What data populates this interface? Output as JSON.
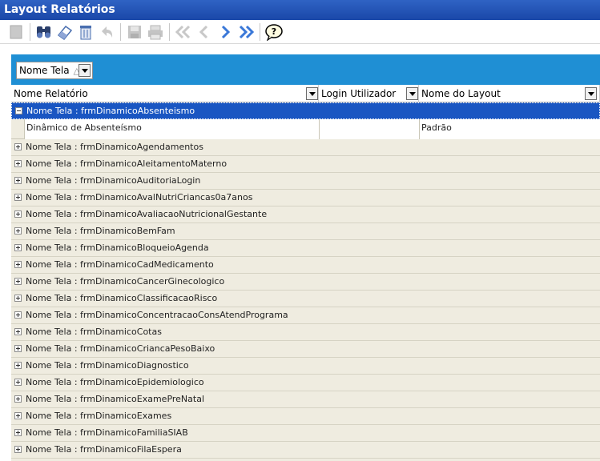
{
  "window": {
    "title": "Layout Relatórios"
  },
  "toolbar": {
    "buttons": [
      {
        "name": "new-icon",
        "enabled": false
      },
      {
        "name": "find-binoculars-icon",
        "enabled": true
      },
      {
        "name": "eraser-icon",
        "enabled": true
      },
      {
        "name": "delete-trash-icon",
        "enabled": true
      },
      {
        "name": "undo-icon",
        "enabled": false
      },
      {
        "name": "save-icon",
        "enabled": false
      },
      {
        "name": "print-icon",
        "enabled": false
      },
      {
        "name": "first-record-icon",
        "enabled": false
      },
      {
        "name": "previous-record-icon",
        "enabled": false
      },
      {
        "name": "next-record-icon",
        "enabled": true
      },
      {
        "name": "last-record-icon",
        "enabled": true
      },
      {
        "name": "help-icon",
        "enabled": true
      }
    ]
  },
  "grouping": {
    "label": "Nome Tela",
    "sort_indicator": "△"
  },
  "columns": {
    "nome_relatorio": "Nome Relatório",
    "login_utilizador": "Login Utilizador",
    "nome_layout": "Nome do Layout"
  },
  "colors": {
    "title_bar": "#1a47a8",
    "panel": "#1f8fd4",
    "selected_row": "#1a56c2",
    "grid_bg": "#efece0"
  },
  "groups": [
    {
      "label": "Nome Tela : frmDinamicoAbsenteismo",
      "expanded": true,
      "selected": true,
      "rows": [
        {
          "nome_relatorio": "Dinâmico de Absenteísmo",
          "login_utilizador": "",
          "nome_layout": "Padrão"
        }
      ]
    },
    {
      "label": "Nome Tela : frmDinamicoAgendamentos"
    },
    {
      "label": "Nome Tela : frmDinamicoAleitamentoMaterno"
    },
    {
      "label": "Nome Tela : frmDinamicoAuditoriaLogin"
    },
    {
      "label": "Nome Tela : frmDinamicoAvalNutriCriancas0a7anos"
    },
    {
      "label": "Nome Tela : frmDinamicoAvaliacaoNutricionalGestante"
    },
    {
      "label": "Nome Tela : frmDinamicoBemFam"
    },
    {
      "label": "Nome Tela : frmDinamicoBloqueioAgenda"
    },
    {
      "label": "Nome Tela : frmDinamicoCadMedicamento"
    },
    {
      "label": "Nome Tela : frmDinamicoCancerGinecologico"
    },
    {
      "label": "Nome Tela : frmDinamicoClassificacaoRisco"
    },
    {
      "label": "Nome Tela : frmDinamicoConcentracaoConsAtendPrograma"
    },
    {
      "label": "Nome Tela : frmDinamicoCotas"
    },
    {
      "label": "Nome Tela : frmDinamicoCriancaPesoBaixo"
    },
    {
      "label": "Nome Tela : frmDinamicoDiagnostico"
    },
    {
      "label": "Nome Tela : frmDinamicoEpidemiologico"
    },
    {
      "label": "Nome Tela : frmDinamicoExamePreNatal"
    },
    {
      "label": "Nome Tela : frmDinamicoExames"
    },
    {
      "label": "Nome Tela : frmDinamicoFamiliaSIAB"
    },
    {
      "label": "Nome Tela : frmDinamicoFilaEspera"
    }
  ]
}
